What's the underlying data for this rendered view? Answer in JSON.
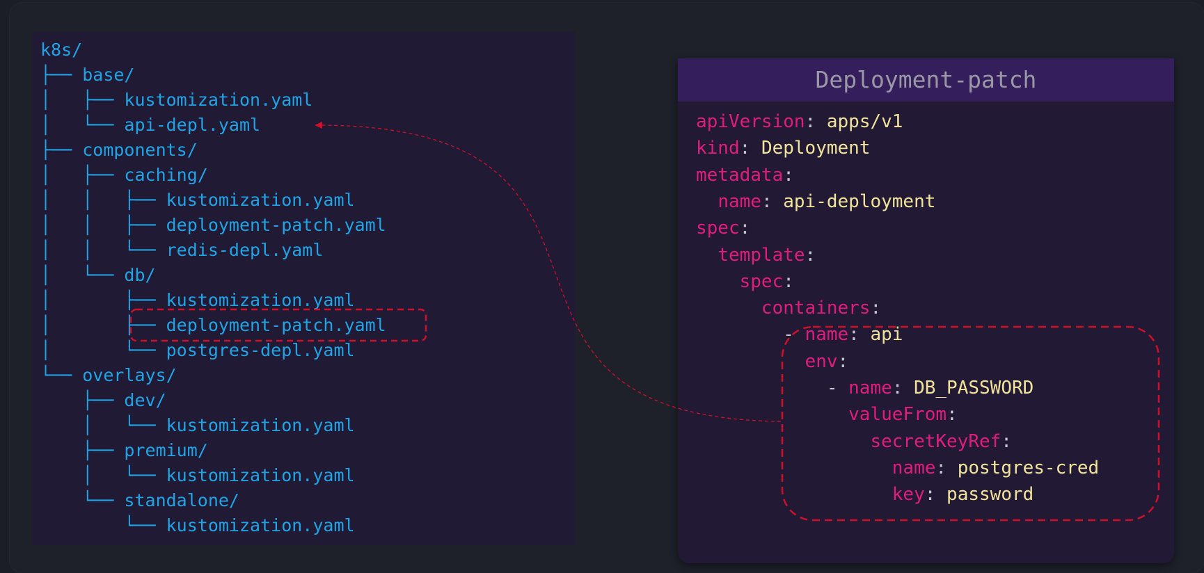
{
  "tree": {
    "lines": [
      {
        "branch": "",
        "name": "k8s/"
      },
      {
        "branch": "├── ",
        "name": "base/"
      },
      {
        "branch": "│   ├── ",
        "name": "kustomization.yaml"
      },
      {
        "branch": "│   └── ",
        "name": "api-depl.yaml"
      },
      {
        "branch": "├── ",
        "name": "components/"
      },
      {
        "branch": "│   ├── ",
        "name": "caching/"
      },
      {
        "branch": "│   │   ├── ",
        "name": "kustomization.yaml"
      },
      {
        "branch": "│   │   ├── ",
        "name": "deployment-patch.yaml"
      },
      {
        "branch": "│   │   └── ",
        "name": "redis-depl.yaml"
      },
      {
        "branch": "│   └── ",
        "name": "db/"
      },
      {
        "branch": "│       ├── ",
        "name": "kustomization.yaml"
      },
      {
        "branch": "│       ├── ",
        "name": "deployment-patch.yaml"
      },
      {
        "branch": "│       └── ",
        "name": "postgres-depl.yaml"
      },
      {
        "branch": "└── ",
        "name": "overlays/"
      },
      {
        "branch": "    ├── ",
        "name": "dev/"
      },
      {
        "branch": "    │   └── ",
        "name": "kustomization.yaml"
      },
      {
        "branch": "    ├── ",
        "name": "premium/"
      },
      {
        "branch": "    │   └── ",
        "name": "kustomization.yaml"
      },
      {
        "branch": "    └── ",
        "name": "standalone/"
      },
      {
        "branch": "        └── ",
        "name": "kustomization.yaml"
      }
    ]
  },
  "yaml_panel": {
    "title": "Deployment-patch",
    "lines": [
      {
        "indent": "",
        "dash": "",
        "key": "apiVersion",
        "sep": ": ",
        "value": "apps/v1"
      },
      {
        "indent": "",
        "dash": "",
        "key": "kind",
        "sep": ": ",
        "value": "Deployment"
      },
      {
        "indent": "",
        "dash": "",
        "key": "metadata",
        "sep": ":",
        "value": ""
      },
      {
        "indent": "  ",
        "dash": "",
        "key": "name",
        "sep": ": ",
        "value": "api-deployment"
      },
      {
        "indent": "",
        "dash": "",
        "key": "spec",
        "sep": ":",
        "value": ""
      },
      {
        "indent": "  ",
        "dash": "",
        "key": "template",
        "sep": ":",
        "value": ""
      },
      {
        "indent": "    ",
        "dash": "",
        "key": "spec",
        "sep": ":",
        "value": ""
      },
      {
        "indent": "      ",
        "dash": "",
        "key": "containers",
        "sep": ":",
        "value": ""
      },
      {
        "indent": "        ",
        "dash": "- ",
        "key": "name",
        "sep": ": ",
        "value": "api"
      },
      {
        "indent": "          ",
        "dash": "",
        "key": "env",
        "sep": ":",
        "value": ""
      },
      {
        "indent": "            ",
        "dash": "- ",
        "key": "name",
        "sep": ": ",
        "value": "DB_PASSWORD"
      },
      {
        "indent": "              ",
        "dash": "",
        "key": "valueFrom",
        "sep": ":",
        "value": ""
      },
      {
        "indent": "                ",
        "dash": "",
        "key": "secretKeyRef",
        "sep": ":",
        "value": ""
      },
      {
        "indent": "                  ",
        "dash": "",
        "key": "name",
        "sep": ": ",
        "value": "postgres-cred"
      },
      {
        "indent": "                  ",
        "dash": "",
        "key": "key",
        "sep": ": ",
        "value": "password"
      }
    ]
  },
  "colors": {
    "tree_text": "#20a4e6",
    "yaml_key": "#e01d7d",
    "yaml_value": "#f2e39a",
    "highlight": "#d0102a"
  }
}
